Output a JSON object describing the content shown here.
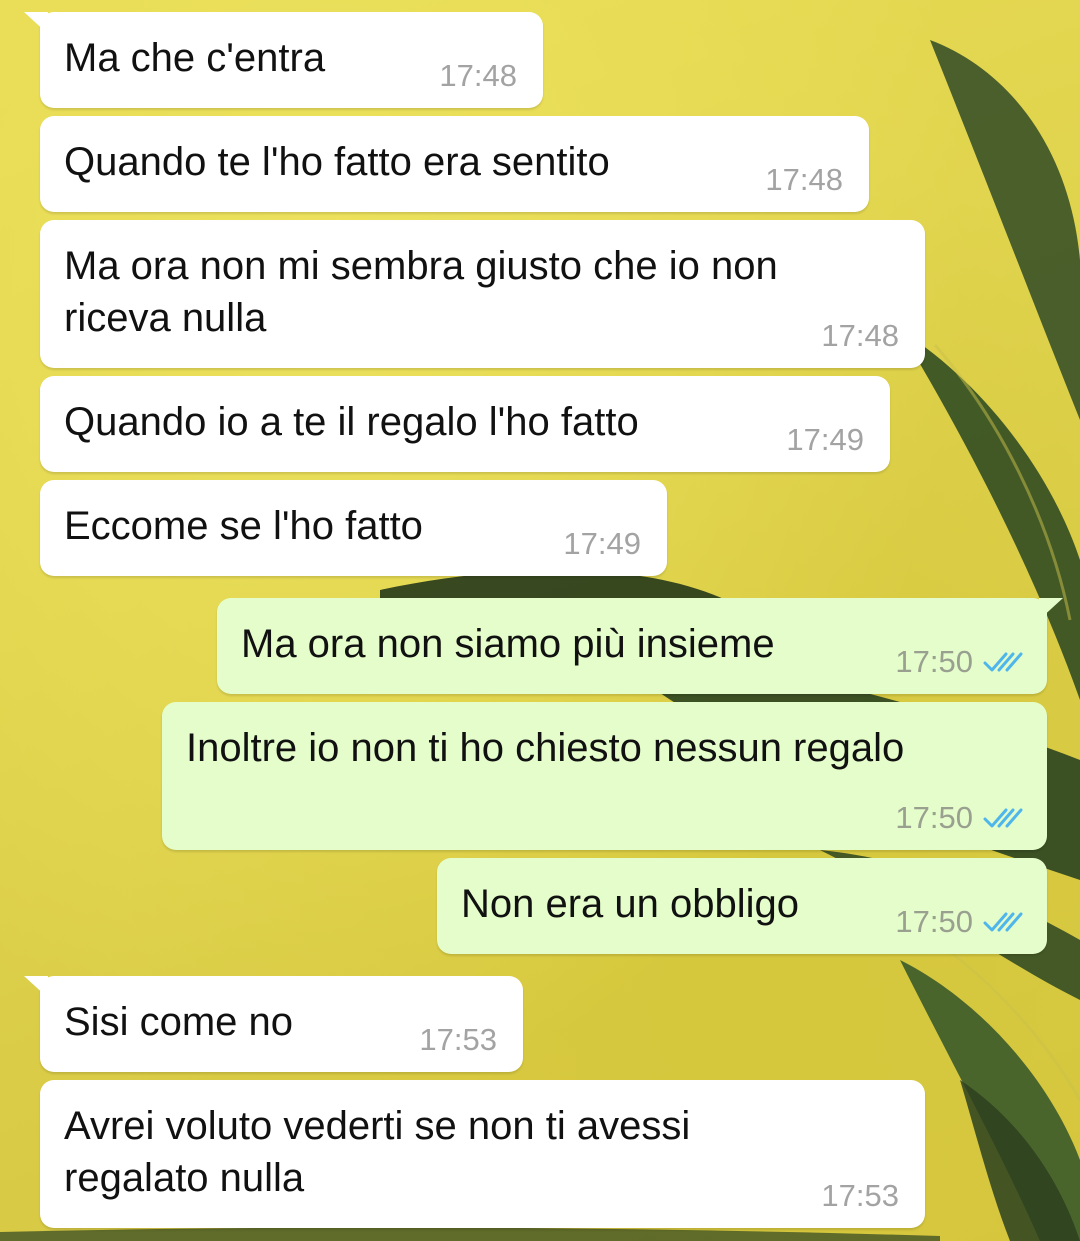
{
  "messages": [
    {
      "direction": "in",
      "text": "Ma che c'entra",
      "time": "17:48"
    },
    {
      "direction": "in",
      "text": "Quando te l'ho fatto era sentito",
      "time": "17:48"
    },
    {
      "direction": "in",
      "text": "Ma ora non mi sembra giusto che io non\nriceva nulla",
      "time": "17:48"
    },
    {
      "direction": "in",
      "text": "Quando io a te il regalo l'ho fatto",
      "time": "17:49"
    },
    {
      "direction": "in",
      "text": "Eccome se l'ho fatto",
      "time": "17:49"
    },
    {
      "direction": "out",
      "text": "Ma ora non siamo più insieme",
      "time": "17:50",
      "status": "read"
    },
    {
      "direction": "out",
      "text": "Inoltre io non ti ho chiesto nessun regalo",
      "time": "17:50",
      "status": "read"
    },
    {
      "direction": "out",
      "text": "Non era un obbligo",
      "time": "17:50",
      "status": "read"
    },
    {
      "direction": "in",
      "text": "Sisi come no",
      "time": "17:53"
    },
    {
      "direction": "in",
      "text": "Avrei voluto vederti se non ti avessi\nregalato nulla",
      "time": "17:53"
    }
  ],
  "icons": {
    "read_receipt": "double-check-icon"
  },
  "colors": {
    "incoming_bubble": "#ffffff",
    "outgoing_bubble": "#e4fdcb",
    "wallpaper": "#dfd34a",
    "read_receipt": "#4fb6ec",
    "timestamp": "#a3a3a3"
  }
}
